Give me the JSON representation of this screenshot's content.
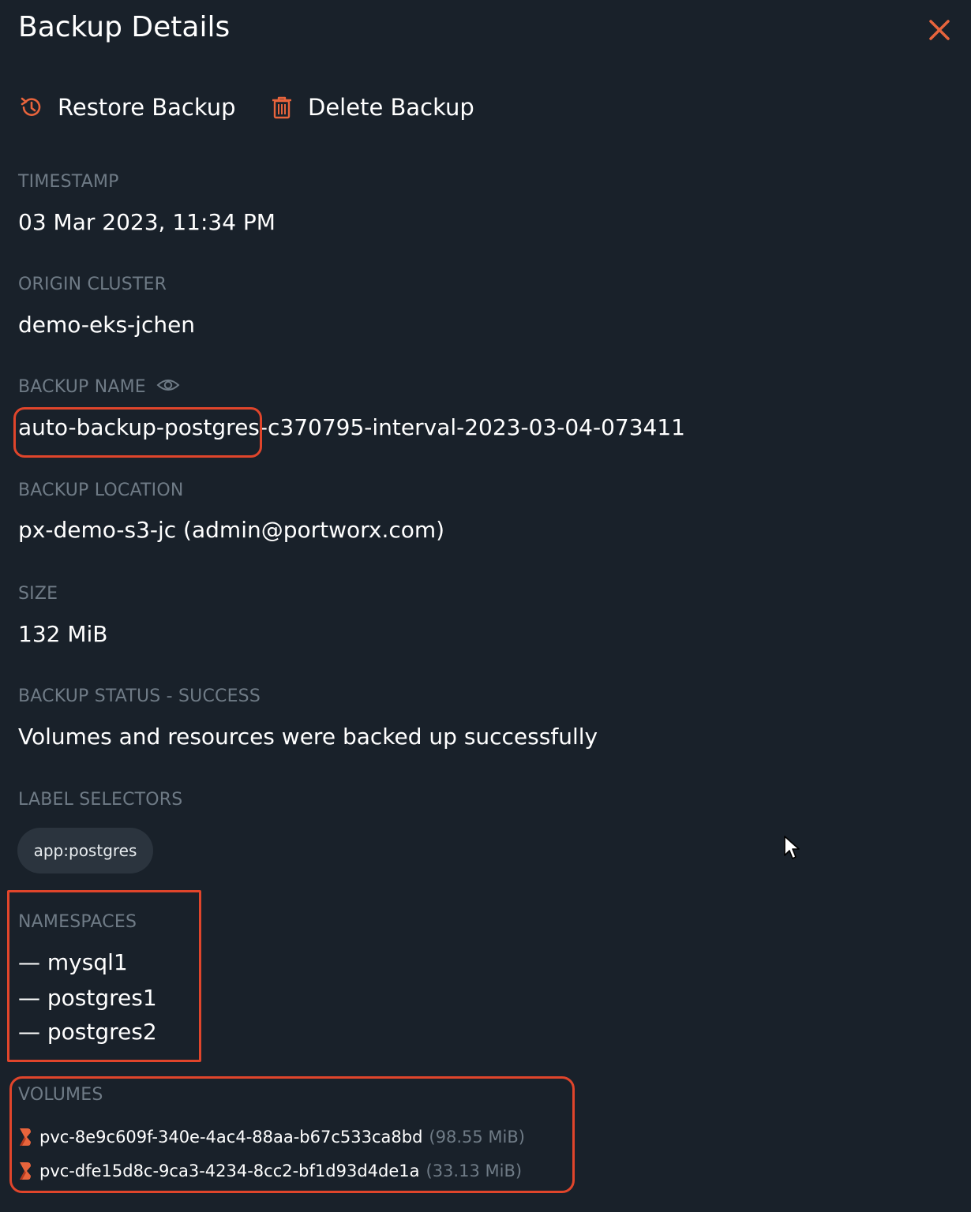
{
  "panel": {
    "title": "Backup Details"
  },
  "actions": {
    "restore_label": "Restore Backup",
    "delete_label": "Delete Backup"
  },
  "fields": {
    "timestamp": {
      "label": "TIMESTAMP",
      "value": "03 Mar 2023, 11:34 PM"
    },
    "origin_cluster": {
      "label": "ORIGIN CLUSTER",
      "value": "demo-eks-jchen"
    },
    "backup_name": {
      "label": "BACKUP NAME",
      "value": "auto-backup-postgres-c370795-interval-2023-03-04-073411"
    },
    "backup_location": {
      "label": "BACKUP LOCATION",
      "value": "px-demo-s3-jc (admin@portworx.com)"
    },
    "size": {
      "label": "SIZE",
      "value": "132 MiB"
    },
    "status": {
      "label": "BACKUP STATUS - SUCCESS",
      "value": "Volumes and resources were backed up successfully"
    },
    "label_selectors": {
      "label": "LABEL SELECTORS",
      "chips": [
        "app:postgres"
      ]
    },
    "namespaces": {
      "label": "NAMESPACES",
      "items": [
        "— mysql1",
        "— postgres1",
        "— postgres2"
      ]
    },
    "volumes": {
      "label": "VOLUMES",
      "items": [
        {
          "name": "pvc-8e9c609f-340e-4ac4-88aa-b67c533ca8bd",
          "size": "(98.55 MiB)"
        },
        {
          "name": "pvc-dfe15d8c-9ca3-4234-8cc2-bf1d93d4de1a",
          "size": "(33.13 MiB)"
        }
      ]
    }
  },
  "colors": {
    "background": "#19212a",
    "accent": "#e8643c",
    "highlight": "#e0452b",
    "muted_label": "#6f7b86"
  },
  "icons": [
    "close-icon",
    "restore-icon",
    "trash-icon",
    "eye-icon",
    "portworx-icon",
    "mouse-cursor-icon"
  ]
}
